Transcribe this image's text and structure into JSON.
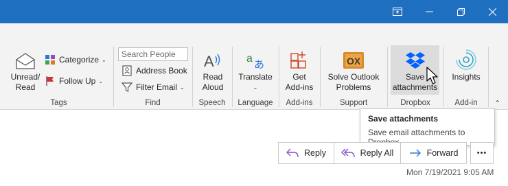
{
  "colors": {
    "titlebar": "#1f6fc0",
    "dropbox_blue": "#0061fe",
    "accent_blue": "#2b78d8",
    "reply_purple": "#8a4fc4",
    "flag_red": "#d13438"
  },
  "titlebar": {
    "icons": [
      "ribbon-display-icon",
      "minimize-icon",
      "restore-icon",
      "close-icon"
    ]
  },
  "ribbon": {
    "tags": {
      "label": "Tags",
      "unread_read": "Unread/\nRead",
      "unread_line1": "Unread/",
      "unread_line2": "Read",
      "categorize": "Categorize",
      "follow_up": "Follow Up"
    },
    "find": {
      "label": "Find",
      "search_people_placeholder": "Search People",
      "address_book": "Address Book",
      "filter_email": "Filter Email"
    },
    "speech": {
      "label": "Speech",
      "read_line1": "Read",
      "read_line2": "Aloud"
    },
    "language": {
      "label": "Language",
      "translate": "Translate"
    },
    "addins": {
      "label": "Add-ins",
      "line1": "Get",
      "line2": "Add-ins"
    },
    "support": {
      "label": "Support",
      "line1": "Solve Outlook",
      "line2": "Problems"
    },
    "dropbox": {
      "label": "Dropbox",
      "line1": "Save",
      "line2": "attachments"
    },
    "addin": {
      "label": "Add-in",
      "insights": "Insights"
    }
  },
  "tooltip": {
    "title": "Save attachments",
    "description": "Save email attachments to Dropbox"
  },
  "message_actions": {
    "reply": "Reply",
    "reply_all": "Reply All",
    "forward": "Forward",
    "more": "•••"
  },
  "timestamp": "Mon 7/19/2021 9:05 AM"
}
